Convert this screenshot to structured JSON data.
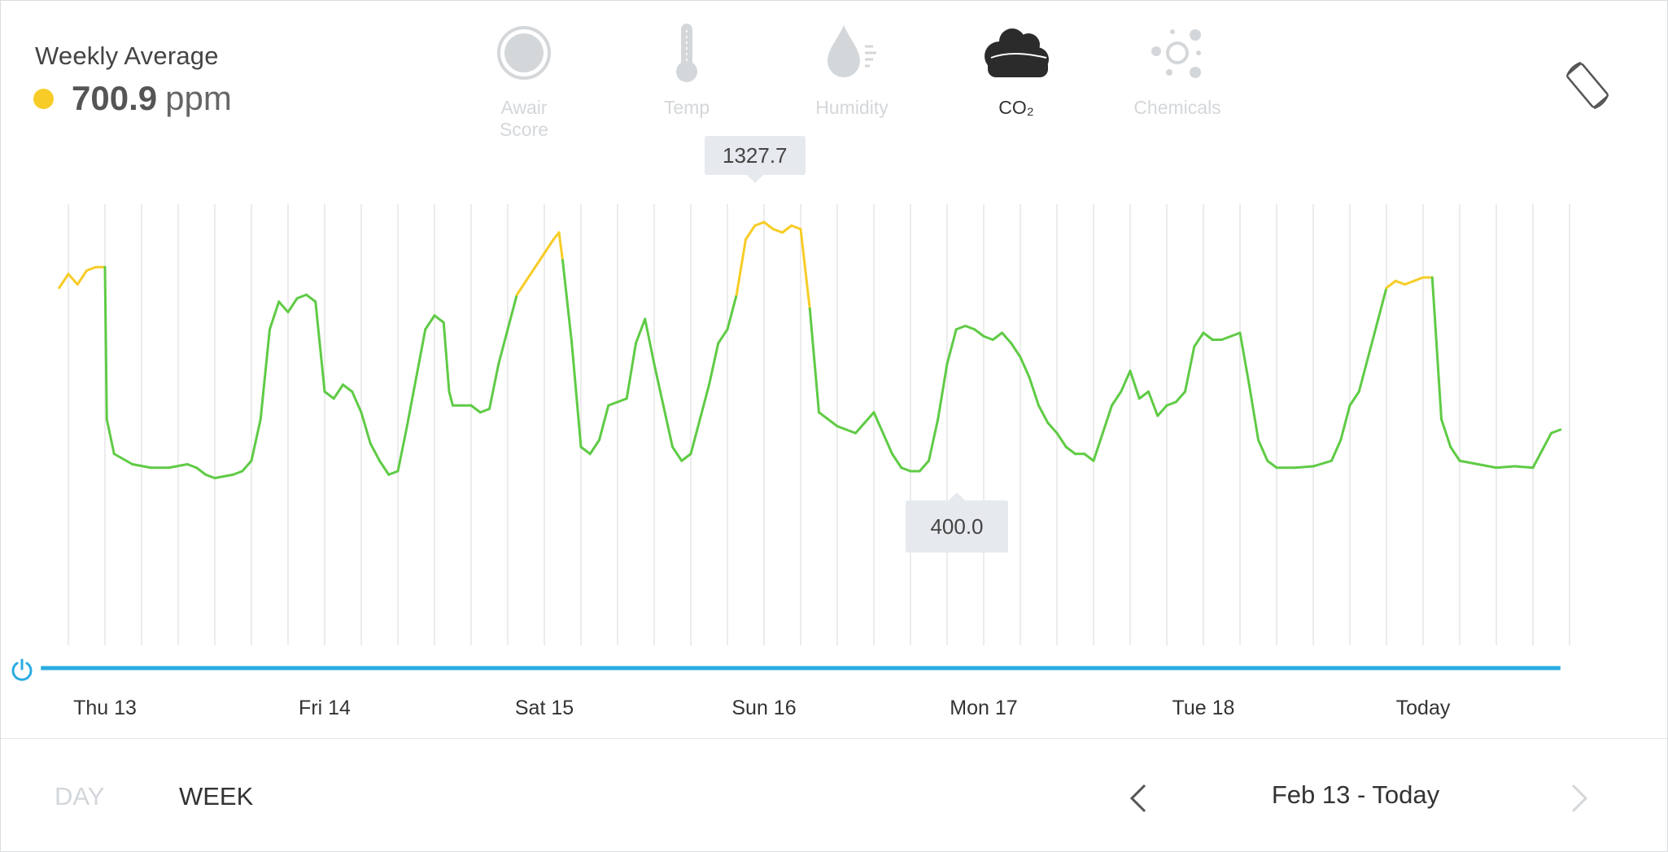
{
  "summary": {
    "label": "Weekly Average",
    "value": "700.9",
    "unit": "ppm",
    "status_color": "#f7cc26"
  },
  "metric_tabs": [
    {
      "label_line1": "Awair",
      "label_line2": "Score",
      "icon": "awair-score-icon",
      "active": false
    },
    {
      "label_line1": "Temp",
      "label_line2": "",
      "icon": "thermometer-icon",
      "active": false
    },
    {
      "label_line1": "Humidity",
      "label_line2": "",
      "icon": "humidity-drop-icon",
      "active": false
    },
    {
      "label_line1": "CO₂",
      "label_line2": "",
      "icon": "cloud-icon",
      "active": true
    },
    {
      "label_line1": "Chemicals",
      "label_line2": "",
      "icon": "chemicals-icon",
      "active": false
    }
  ],
  "chart_data": {
    "type": "line",
    "metric": "CO₂",
    "unit": "ppm",
    "x_tick_labels": [
      "Thu 13",
      "Fri 14",
      "Sat 15",
      "Sun 16",
      "Mon 17",
      "Tue 18",
      "Today"
    ],
    "x_unit": "hours since start of Thu 13",
    "grid": "vertical lines every 4 hours",
    "colors": {
      "good": "#5fcb45",
      "moderate": "#f7cc26",
      "device_bar": "#29abe2"
    },
    "series": [
      {
        "points": [
          [
            -5,
            1010
          ],
          [
            -4,
            1030
          ],
          [
            -3,
            1015
          ],
          [
            -2,
            1035
          ],
          [
            -1,
            1040
          ],
          [
            0,
            1040
          ],
          [
            0.2,
            820
          ],
          [
            1,
            770
          ],
          [
            3,
            755
          ],
          [
            5,
            750
          ],
          [
            7,
            750
          ],
          [
            9,
            755
          ],
          [
            10,
            750
          ],
          [
            11,
            740
          ],
          [
            12,
            735
          ],
          [
            14,
            740
          ],
          [
            15,
            745
          ],
          [
            16,
            760
          ],
          [
            17,
            820
          ],
          [
            18,
            950
          ],
          [
            19,
            990
          ],
          [
            20,
            975
          ],
          [
            21,
            995
          ],
          [
            22,
            1000
          ],
          [
            23,
            990
          ],
          [
            24,
            860
          ],
          [
            25,
            850
          ],
          [
            26,
            870
          ],
          [
            27,
            860
          ],
          [
            28,
            830
          ],
          [
            29,
            785
          ],
          [
            30,
            760
          ],
          [
            31,
            740
          ],
          [
            32,
            745
          ],
          [
            33,
            810
          ],
          [
            34,
            880
          ],
          [
            35,
            950
          ],
          [
            36,
            970
          ],
          [
            37,
            960
          ],
          [
            37.6,
            860
          ],
          [
            38,
            840
          ],
          [
            40,
            840
          ],
          [
            41,
            830
          ],
          [
            42,
            835
          ],
          [
            43,
            900
          ],
          [
            44,
            950
          ],
          [
            45,
            1000
          ],
          [
            46,
            1020
          ],
          [
            47,
            1040
          ],
          [
            48,
            1060
          ],
          [
            49,
            1080
          ],
          [
            49.6,
            1090
          ],
          [
            50,
            1050
          ],
          [
            51,
            930
          ],
          [
            52,
            780
          ],
          [
            53,
            770
          ],
          [
            54,
            790
          ],
          [
            55,
            840
          ],
          [
            57,
            850
          ],
          [
            58,
            930
          ],
          [
            59,
            965
          ],
          [
            60,
            900
          ],
          [
            61,
            840
          ],
          [
            62,
            780
          ],
          [
            63,
            760
          ],
          [
            64,
            770
          ],
          [
            65,
            820
          ],
          [
            66,
            870
          ],
          [
            67,
            930
          ],
          [
            68,
            950
          ],
          [
            69,
            1000
          ],
          [
            70,
            1080
          ],
          [
            71,
            1100
          ],
          [
            72,
            1105
          ],
          [
            73,
            1095
          ],
          [
            74,
            1090
          ],
          [
            75,
            1100
          ],
          [
            76,
            1095
          ],
          [
            77,
            980
          ],
          [
            78,
            830
          ],
          [
            80,
            810
          ],
          [
            81,
            805
          ],
          [
            82,
            800
          ],
          [
            83,
            815
          ],
          [
            84,
            830
          ],
          [
            85,
            800
          ],
          [
            86,
            770
          ],
          [
            87,
            750
          ],
          [
            88,
            745
          ],
          [
            89,
            745
          ],
          [
            90,
            760
          ],
          [
            91,
            820
          ],
          [
            92,
            900
          ],
          [
            93,
            950
          ],
          [
            94,
            955
          ],
          [
            95,
            950
          ],
          [
            96,
            940
          ],
          [
            97,
            935
          ],
          [
            98,
            945
          ],
          [
            99,
            930
          ],
          [
            100,
            910
          ],
          [
            101,
            880
          ],
          [
            102,
            840
          ],
          [
            103,
            815
          ],
          [
            104,
            800
          ],
          [
            105,
            780
          ],
          [
            106,
            770
          ],
          [
            107,
            770
          ],
          [
            108,
            760
          ],
          [
            109,
            800
          ],
          [
            110,
            840
          ],
          [
            111,
            860
          ],
          [
            112,
            890
          ],
          [
            113,
            850
          ],
          [
            114,
            860
          ],
          [
            115,
            825
          ],
          [
            116,
            840
          ],
          [
            117,
            845
          ],
          [
            118,
            860
          ],
          [
            119,
            925
          ],
          [
            120,
            945
          ],
          [
            121,
            935
          ],
          [
            122,
            935
          ],
          [
            123,
            940
          ],
          [
            124,
            945
          ],
          [
            125,
            870
          ],
          [
            126,
            790
          ],
          [
            127,
            760
          ],
          [
            128,
            750
          ],
          [
            130,
            750
          ],
          [
            132,
            752
          ],
          [
            134,
            760
          ],
          [
            135,
            790
          ],
          [
            136,
            840
          ],
          [
            137,
            860
          ],
          [
            138,
            910
          ],
          [
            139,
            960
          ],
          [
            140,
            1010
          ],
          [
            141,
            1020
          ],
          [
            142,
            1015
          ],
          [
            143,
            1020
          ],
          [
            144,
            1025
          ],
          [
            145,
            1025
          ],
          [
            146,
            820
          ],
          [
            147,
            780
          ],
          [
            148,
            760
          ],
          [
            150,
            755
          ],
          [
            152,
            750
          ],
          [
            154,
            752
          ],
          [
            156,
            750
          ],
          [
            157,
            775
          ],
          [
            158,
            800
          ],
          [
            159,
            805
          ]
        ]
      }
    ],
    "annotations": [
      {
        "label": "1327.7",
        "x": 71,
        "y": 1105
      },
      {
        "label": "400.0",
        "x": 88,
        "y": 745
      }
    ]
  },
  "footer": {
    "day_label": "DAY",
    "week_label": "WEEK",
    "date_range": "Feb 13 - Today"
  }
}
